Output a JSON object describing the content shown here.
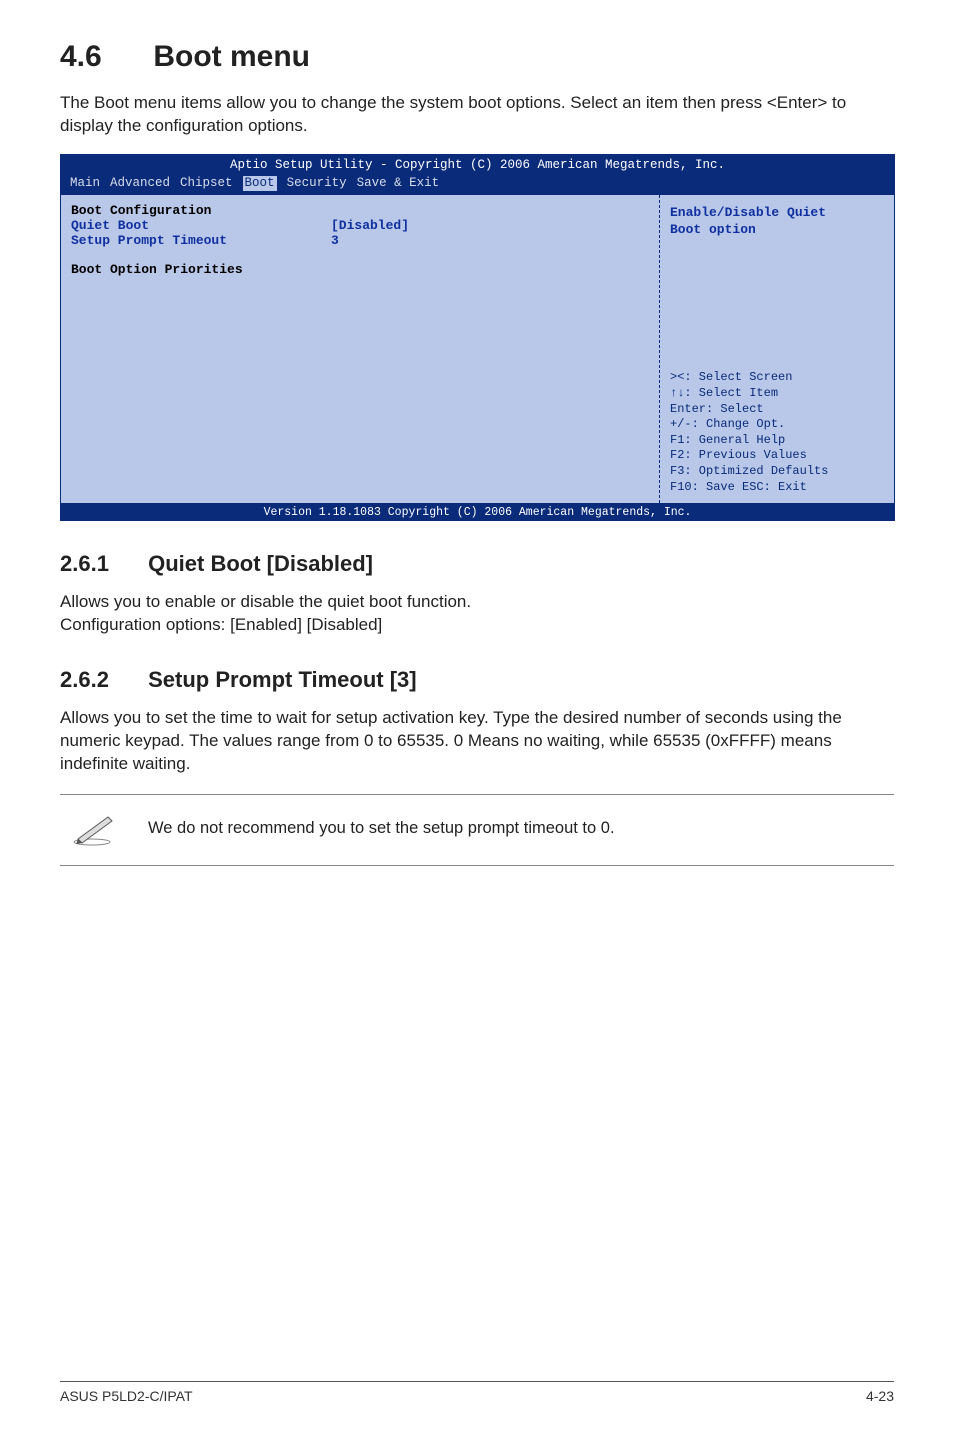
{
  "section": {
    "number": "4.6",
    "title": "Boot menu"
  },
  "intro": "The Boot menu items allow you to change the system boot options. Select an item then press <Enter> to display the configuration options.",
  "bios": {
    "top_line": "Aptio Setup Utility - Copyright (C) 2006 American Megatrends, Inc.",
    "menu": [
      "Main",
      "Advanced",
      "Chipset",
      "Boot",
      "Security",
      "Save & Exit"
    ],
    "left": {
      "heading1": "Boot Configuration",
      "row1_label": "Quiet Boot",
      "row1_value": "[Disabled]",
      "row2_label": "Setup Prompt Timeout",
      "row2_value": "3",
      "heading2": "Boot Option Priorities"
    },
    "right": {
      "hint1": "Enable/Disable Quiet",
      "hint2": "Boot option",
      "keys": [
        "><: Select Screen",
        "↑↓: Select Item",
        "Enter: Select",
        "+/-: Change Opt.",
        "F1: General Help",
        "F2: Previous Values",
        "F3: Optimized Defaults",
        "F10: Save  ESC: Exit"
      ]
    },
    "footer": "Version 1.18.1083 Copyright (C) 2006 American Megatrends, Inc."
  },
  "sub1": {
    "number": "2.6.1",
    "title": "Quiet Boot [Disabled]",
    "text": "Allows you to enable or disable the quiet boot function.\nConfiguration options: [Enabled] [Disabled]"
  },
  "sub2": {
    "number": "2.6.2",
    "title": "Setup Prompt Timeout [3]",
    "text": "Allows you to set the time to wait for setup activation key. Type the desired number of seconds using the numeric keypad. The values range from 0 to 65535. 0 Means no waiting, while 65535 (0xFFFF) means indefinite waiting."
  },
  "note": "We do not recommend you to set the setup prompt timeout to 0.",
  "footer": {
    "left": "ASUS P5LD2-C/IPAT",
    "right": "4-23"
  }
}
